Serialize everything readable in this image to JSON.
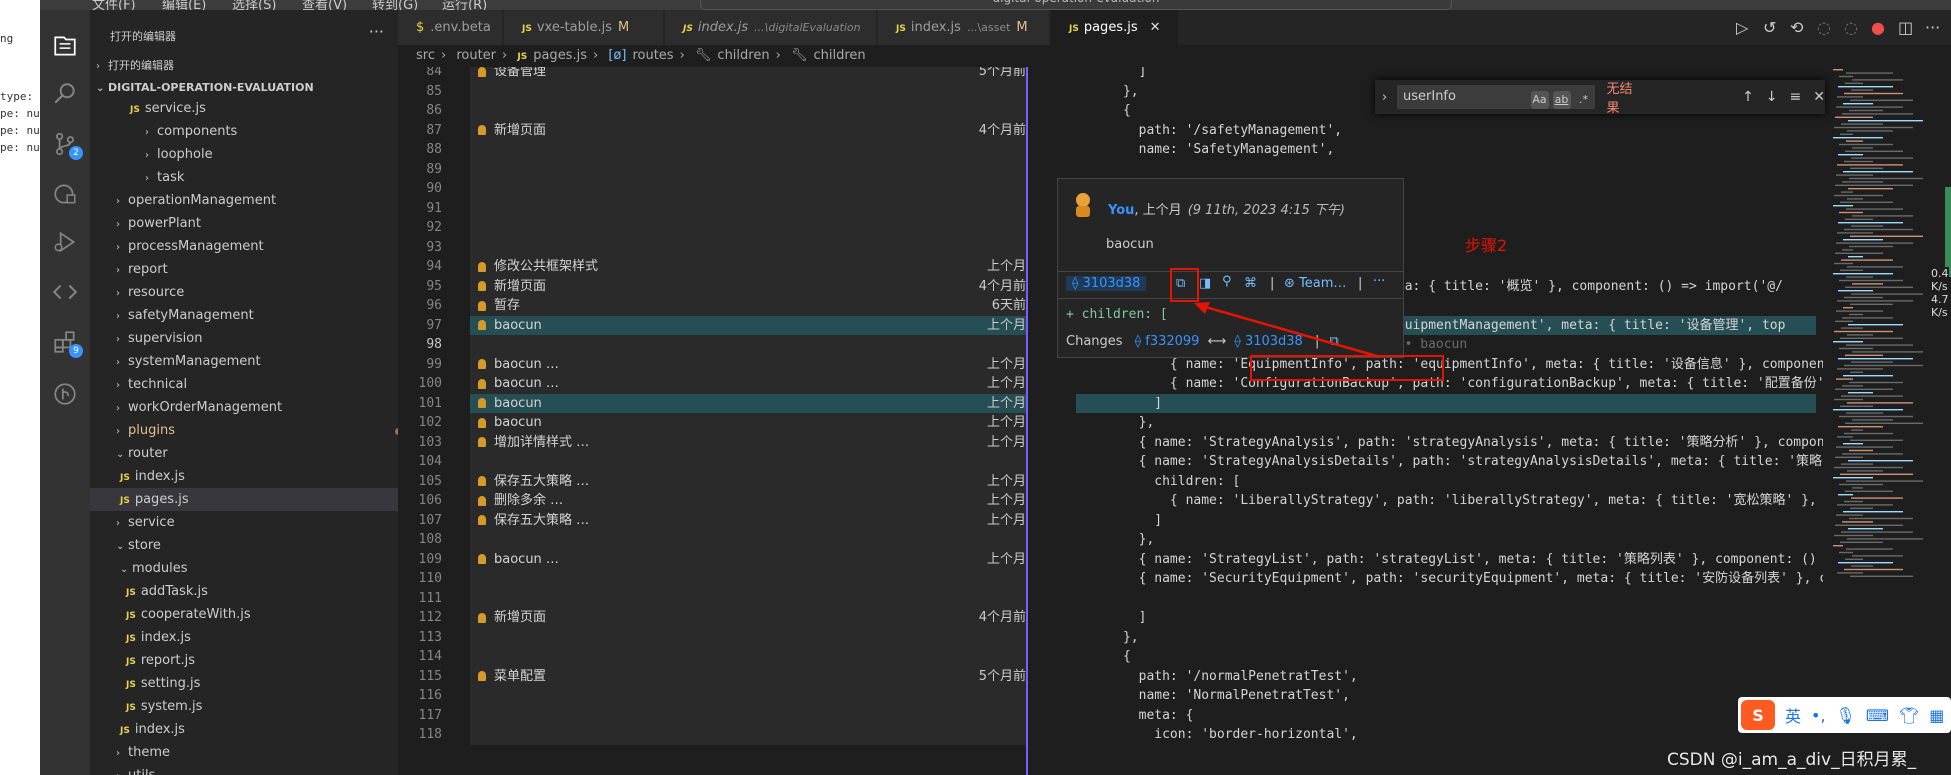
{
  "left_window": {
    "lines": [
      "ng",
      "type:",
      "pe: nu",
      "pe: nu",
      "pe: nu"
    ]
  },
  "titlebar": {
    "menus": [
      "文件(F)",
      "编辑(E)",
      "选择(S)",
      "查看(V)",
      "转到(G)",
      "运行(R)"
    ],
    "search": "digital-operation-evaluation"
  },
  "activity": {
    "scm_badge": "2",
    "ext_badge": "9"
  },
  "sidebar": {
    "open_editors_header": "打开的编辑器",
    "open_editors_section": "打开的编辑器",
    "project": "DIGITAL-OPERATION-EVALUATION",
    "tree": [
      {
        "label": "service.js",
        "type": "file"
      },
      {
        "label": "components",
        "type": "folder"
      },
      {
        "label": "loophole",
        "type": "folder"
      },
      {
        "label": "task",
        "type": "folder"
      },
      {
        "label": "operationManagement",
        "type": "folder"
      },
      {
        "label": "powerPlant",
        "type": "folder"
      },
      {
        "label": "processManagement",
        "type": "folder"
      },
      {
        "label": "report",
        "type": "folder"
      },
      {
        "label": "resource",
        "type": "folder"
      },
      {
        "label": "safetyManagement",
        "type": "folder"
      },
      {
        "label": "supervision",
        "type": "folder"
      },
      {
        "label": "systemManagement",
        "type": "folder"
      },
      {
        "label": "technical",
        "type": "folder"
      },
      {
        "label": "workOrderManagement",
        "type": "folder"
      },
      {
        "label": "plugins",
        "type": "folder"
      },
      {
        "label": "router",
        "type": "folder-open"
      },
      {
        "label": "index.js",
        "type": "file"
      },
      {
        "label": "pages.js",
        "type": "file"
      },
      {
        "label": "service",
        "type": "folder"
      },
      {
        "label": "store",
        "type": "folder-open"
      },
      {
        "label": "modules",
        "type": "folder-open"
      },
      {
        "label": "addTask.js",
        "type": "file"
      },
      {
        "label": "cooperateWith.js",
        "type": "file"
      },
      {
        "label": "index.js",
        "type": "file"
      },
      {
        "label": "report.js",
        "type": "file"
      },
      {
        "label": "setting.js",
        "type": "file"
      },
      {
        "label": "system.js",
        "type": "file"
      },
      {
        "label": "index.js",
        "type": "file"
      },
      {
        "label": "theme",
        "type": "folder"
      },
      {
        "label": "utils",
        "type": "folder"
      }
    ]
  },
  "tabs": [
    {
      "label": ".env.beta",
      "desc": "",
      "mod": ""
    },
    {
      "label": "vxe-table.js",
      "desc": "",
      "mod": "M"
    },
    {
      "label": "index.js",
      "desc": "...\\digitalEvaluation",
      "mod": ""
    },
    {
      "label": "index.js",
      "desc": "...\\asset",
      "mod": "M"
    },
    {
      "label": "pages.js",
      "desc": "",
      "mod": ""
    }
  ],
  "breadcrumb": [
    "src",
    "router",
    "pages.js",
    "routes",
    "children",
    "children"
  ],
  "editor": {
    "lines": [
      {
        "n": "84",
        "blame": "设备管理",
        "when": "5个月前",
        "code": "        ]"
      },
      {
        "n": "85",
        "blame": "",
        "when": "",
        "code": "      },"
      },
      {
        "n": "86",
        "blame": "",
        "when": "",
        "code": "      {"
      },
      {
        "n": "87",
        "blame": "新增页面",
        "when": "4个月前",
        "code": "        path: '/safetyManagement',"
      },
      {
        "n": "88",
        "blame": "",
        "when": "",
        "code": "        name: 'SafetyManagement',"
      },
      {
        "n": "89",
        "blame": "",
        "when": "",
        "code": ""
      },
      {
        "n": "90",
        "blame": "",
        "when": "",
        "code": ""
      },
      {
        "n": "91",
        "blame": "",
        "when": "",
        "code": ""
      },
      {
        "n": "92",
        "blame": "",
        "when": "",
        "code": ""
      },
      {
        "n": "93",
        "blame": "",
        "when": "",
        "code": ""
      },
      {
        "n": "94",
        "blame": "修改公共框架样式",
        "when": "上个月",
        "code": "                                       '',"
      },
      {
        "n": "95",
        "blame": "新增页面",
        "when": "4个月前",
        "code": "                                       meta: { title: '概览' }, component: () => import('@/"
      },
      {
        "n": "96",
        "blame": "暂存",
        "when": "6天前",
        "code": ""
      },
      {
        "n": "97",
        "blame": "baocun",
        "when": "上个月",
        "code": "                                       'equipmentManagement', meta: { title: '设备管理', top"
      },
      {
        "n": "98",
        "blame": "",
        "when": "",
        "code": "          children: [          You, 上个月 • baocun"
      },
      {
        "n": "99",
        "blame": "baocun …",
        "when": "上个月",
        "code": "            { name: 'EquipmentInfo', path: 'equipmentInfo', meta: { title: '设备信息' }, component"
      },
      {
        "n": "100",
        "blame": "baocun …",
        "when": "上个月",
        "code": "            { name: 'ConfigurationBackup', path: 'configurationBackup', meta: { title: '配置备份'"
      },
      {
        "n": "101",
        "blame": "baocun",
        "when": "上个月",
        "code": "          ]"
      },
      {
        "n": "102",
        "blame": "baocun",
        "when": "上个月",
        "code": "        },"
      },
      {
        "n": "103",
        "blame": "增加详情样式 …",
        "when": "上个月",
        "code": "        { name: 'StrategyAnalysis', path: 'strategyAnalysis', meta: { title: '策略分析' }, compone"
      },
      {
        "n": "104",
        "blame": "",
        "when": "",
        "code": "        { name: 'StrategyAnalysisDetails', path: 'strategyAnalysisDetails', meta: { title: '策略分"
      },
      {
        "n": "105",
        "blame": "保存五大策略 …",
        "when": "上个月",
        "code": "          children: ["
      },
      {
        "n": "106",
        "blame": "删除多余 …",
        "when": "上个月",
        "code": "            { name: 'LiberallyStrategy', path: 'liberallyStrategy', meta: { title: '宽松策略' }, c"
      },
      {
        "n": "107",
        "blame": "保存五大策略 …",
        "when": "上个月",
        "code": "          ]"
      },
      {
        "n": "108",
        "blame": "",
        "when": "",
        "code": "        },"
      },
      {
        "n": "109",
        "blame": "baocun …",
        "when": "上个月",
        "code": "        { name: 'StrategyList', path: 'strategyList', meta: { title: '策略列表' }, component: () ="
      },
      {
        "n": "110",
        "blame": "",
        "when": "",
        "code": "        { name: 'SecurityEquipment', path: 'securityEquipment', meta: { title: '安防设备列表' }, c"
      },
      {
        "n": "111",
        "blame": "",
        "when": "",
        "code": ""
      },
      {
        "n": "112",
        "blame": "新增页面",
        "when": "4个月前",
        "code": "        ]"
      },
      {
        "n": "113",
        "blame": "",
        "when": "",
        "code": "      },"
      },
      {
        "n": "114",
        "blame": "",
        "when": "",
        "code": "      {"
      },
      {
        "n": "115",
        "blame": "菜单配置",
        "when": "5个月前",
        "code": "        path: '/normalPenetratTest',"
      },
      {
        "n": "116",
        "blame": "",
        "when": "",
        "code": "        name: 'NormalPenetratTest',"
      },
      {
        "n": "117",
        "blame": "",
        "when": "",
        "code": "        meta: {"
      },
      {
        "n": "118",
        "blame": "",
        "when": "",
        "code": "          icon: 'border-horizontal',"
      }
    ]
  },
  "find": {
    "value": "userInfo",
    "opt1": "Aa",
    "opt2": "ab",
    "opt3": ".*",
    "result": "无结果"
  },
  "hover": {
    "author": "You",
    "rel": "上个月",
    "date": "(9 11th, 2023 4:15 下午)",
    "message": "baocun",
    "sha": "3103d38",
    "team": "Team…",
    "diff": "+ children: [",
    "changes_label": "Changes",
    "from_sha": "f332099",
    "arrow": "⟷",
    "to_sha": "3103d38"
  },
  "annotation": {
    "step": "步骤2"
  },
  "minimap": {
    "right_1": "0.4",
    "right_2": "K/s",
    "right_3": "4.7",
    "right_4": "K/s"
  },
  "ime": {
    "lang": "英",
    "punct": "•,"
  },
  "watermark": "CSDN @i_am_a_div_日积月累_"
}
